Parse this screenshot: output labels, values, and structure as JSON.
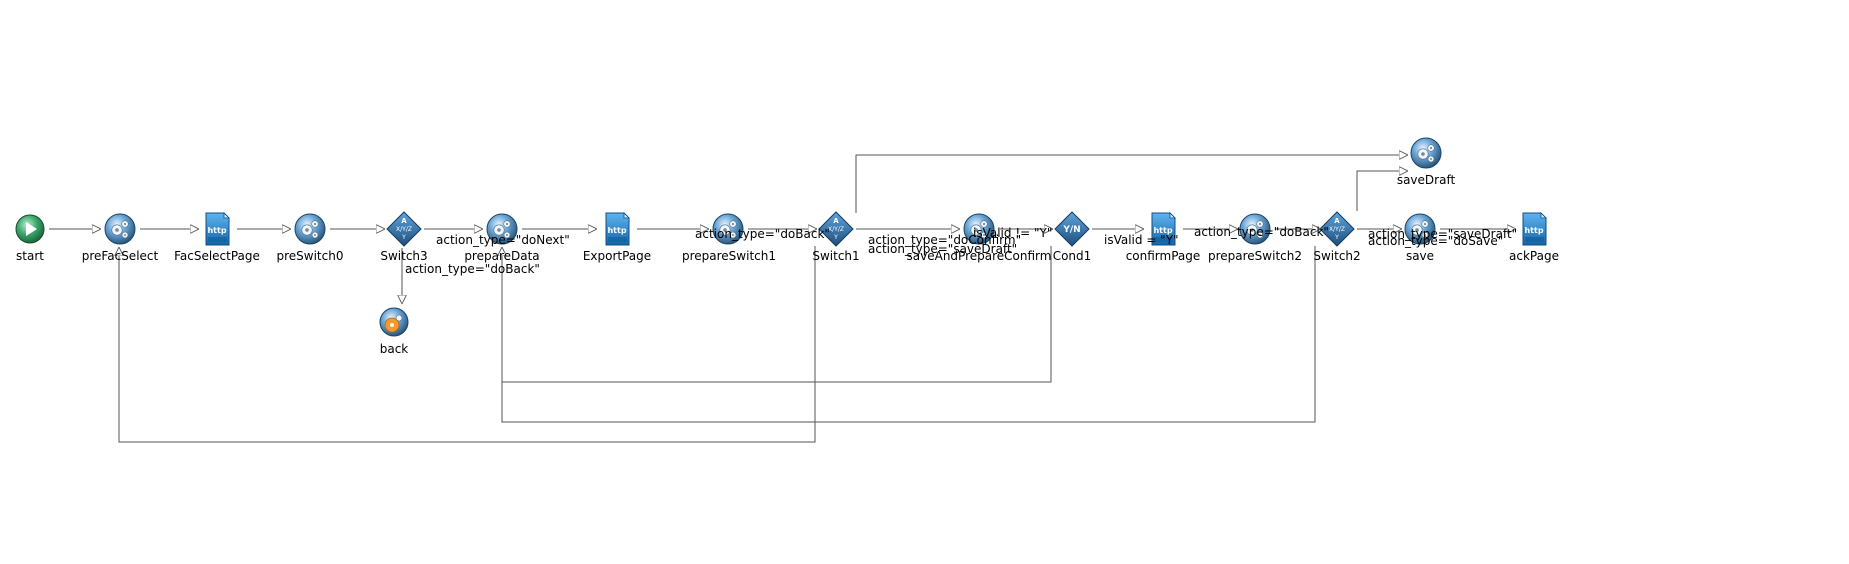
{
  "nodes": [
    {
      "id": "start",
      "label": "start",
      "icon": "play-icon"
    },
    {
      "id": "preFacSelect",
      "label": "preFacSelect",
      "icon": "gear-icon"
    },
    {
      "id": "FacSelectPage",
      "label": "FacSelectPage",
      "icon": "http-page-icon"
    },
    {
      "id": "preSwitch0",
      "label": "preSwitch0",
      "icon": "gear-icon"
    },
    {
      "id": "Switch3",
      "label": "Switch3",
      "icon": "switch-icon"
    },
    {
      "id": "back",
      "label": "back",
      "icon": "gear-icon"
    },
    {
      "id": "prepareData",
      "label": "prepareData",
      "icon": "gear-icon"
    },
    {
      "id": "ExportPage",
      "label": "ExportPage",
      "icon": "http-page-icon"
    },
    {
      "id": "prepareSwitch1",
      "label": "prepareSwitch1",
      "icon": "gear-icon"
    },
    {
      "id": "Switch1",
      "label": "Switch1",
      "icon": "switch-icon"
    },
    {
      "id": "saveAndPrepareConfirm",
      "label": "saveAndPrepareConfirm",
      "icon": "gear-icon"
    },
    {
      "id": "Cond1",
      "label": "Cond1",
      "icon": "yn-condition-icon"
    },
    {
      "id": "confirmPage",
      "label": "confirmPage",
      "icon": "http-page-icon"
    },
    {
      "id": "prepareSwitch2",
      "label": "prepareSwitch2",
      "icon": "gear-icon"
    },
    {
      "id": "Switch2",
      "label": "Switch2",
      "icon": "switch-icon"
    },
    {
      "id": "saveDraft",
      "label": "saveDraft",
      "icon": "gear-icon"
    },
    {
      "id": "save",
      "label": "save",
      "icon": "gear-icon"
    },
    {
      "id": "ackPage",
      "label": "ackPage",
      "icon": "http-page-icon"
    }
  ],
  "edge_labels": [
    {
      "id": "switch3-donext",
      "text": "action_type=\"doNext\""
    },
    {
      "id": "switch3-doback",
      "text": "action_type=\"doBack\""
    },
    {
      "id": "switch1-doback",
      "text": "action_type=\"doBack\""
    },
    {
      "id": "switch1-doconfirm",
      "text": "action_type=\"doConfirm\""
    },
    {
      "id": "switch1-savedraft",
      "text": "action_type=\"saveDraft\""
    },
    {
      "id": "cond1-notvalid",
      "text": "isValid != \"Y\""
    },
    {
      "id": "cond1-valid",
      "text": "isValid = \"Y\""
    },
    {
      "id": "switch2-doback",
      "text": "action_type=\"doBack\""
    },
    {
      "id": "switch2-savedraft",
      "text": "action_type=\"saveDraft\""
    },
    {
      "id": "switch2-dosave",
      "text": "action_type=\"doSave\""
    }
  ],
  "colors": {
    "edge": "#555555",
    "text": "#000000",
    "gear_dark": "#2a5f86",
    "gear_light": "#cfe7f7",
    "page_blue": "#1e7cc8",
    "switch_blue": "#2f6ea8",
    "start_green": "#2e8b57",
    "back_orange": "#f29a2e"
  }
}
